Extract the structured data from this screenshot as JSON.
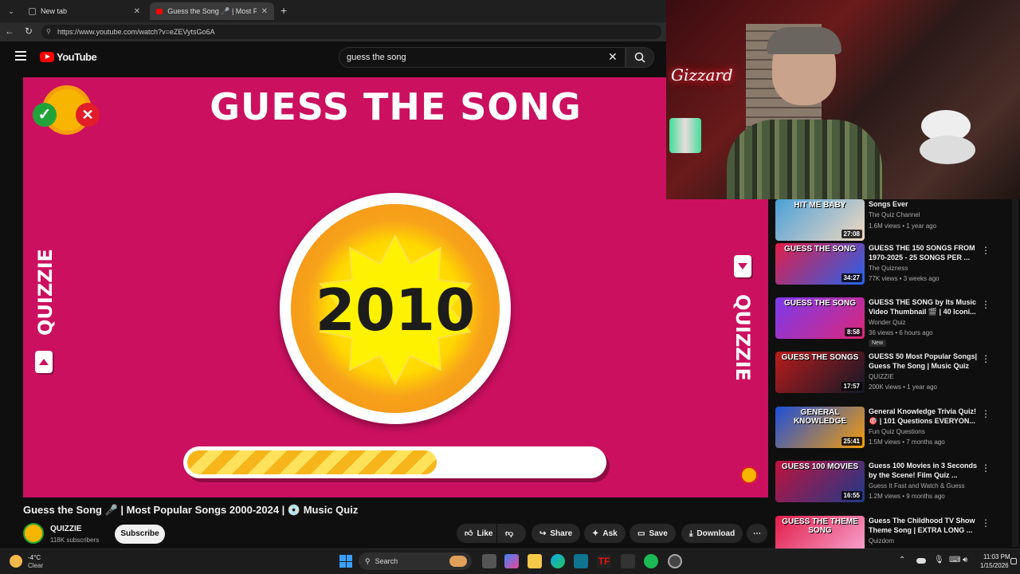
{
  "browser": {
    "tabs": [
      {
        "label": "New tab"
      },
      {
        "label": "Guess the Song 🎤 | Most Popula"
      }
    ],
    "url": "https://www.youtube.com/watch?v=eZEVytsGo6A"
  },
  "youtube": {
    "logo_text": "YouTube",
    "search_value": "guess the song"
  },
  "video": {
    "overlay_title": "GUESS THE SONG",
    "year": "2010",
    "side_label_left": "QUIZZIE",
    "side_label_right": "QUIZZIE",
    "progress_fraction": 0.6,
    "title": "Guess the Song 🎤 | Most Popular Songs 2000-2024 | 💿 Music Quiz",
    "channel": "QUIZZIE",
    "subscribers": "118K subscribers",
    "subscribe_label": "Subscribe",
    "actions": {
      "like": "Like",
      "share": "Share",
      "ask": "Ask",
      "save": "Save",
      "download": "Download"
    }
  },
  "webcam": {
    "neon_sign": "Gizzard"
  },
  "recommendations": [
    {
      "title": "Songs Ever",
      "channel": "The Quiz Channel",
      "meta": "1.6M views • 1 year ago",
      "duration": "27:08",
      "thumb_text": "HIT ME BABY",
      "colors": [
        "#4aa0d8",
        "#f3d9c0"
      ]
    },
    {
      "title": "GUESS THE 150 SONGS FROM 1970-2025 - 25 SONGS PER ...",
      "channel": "The Quizness",
      "meta": "77K views • 3 weeks ago",
      "duration": "34:27",
      "thumb_text": "GUESS THE SONG",
      "colors": [
        "#e11d48",
        "#2563eb"
      ]
    },
    {
      "title": "GUESS THE SONG by Its Music Video Thumbnail 🎬 | 40 Iconi...",
      "channel": "Wonder Quiz",
      "meta": "36 views • 6 hours ago",
      "duration": "8:58",
      "badge": "New",
      "thumb_text": "GUESS THE SONG",
      "colors": [
        "#7c3aed",
        "#db2777"
      ]
    },
    {
      "title": "GUESS 50 Most Popular Songs| Guess The Song | Music Quiz",
      "channel": "QUIZZIE",
      "meta": "200K views • 1 year ago",
      "duration": "17:57",
      "thumb_text": "GUESS THE SONGS",
      "colors": [
        "#b91c1c",
        "#111827"
      ]
    },
    {
      "title": "General Knowledge Trivia Quiz! 🎯 | 101 Questions EVERYON...",
      "channel": "Fun Quiz Questions",
      "meta": "1.5M views • 7 months ago",
      "duration": "25:41",
      "thumb_text": "GENERAL KNOWLEDGE",
      "colors": [
        "#1d4ed8",
        "#f59e0b"
      ]
    },
    {
      "title": "Guess 100 Movies in 3 Seconds by the Scene! Film Quiz ...",
      "channel": "Guess It Fast and Watch & Guess",
      "meta": "1.2M views • 9 months ago",
      "duration": "16:55",
      "thumb_text": "GUESS 100 MOVIES",
      "colors": [
        "#be123c",
        "#1e3a8a"
      ]
    },
    {
      "title": "Guess The Childhood TV Show Theme Song | EXTRA LONG ...",
      "channel": "Quizdom",
      "meta": "",
      "duration": "",
      "thumb_text": "GUESS THE THEME SONG",
      "colors": [
        "#e11d48",
        "#f9a8d4"
      ]
    }
  ],
  "taskbar": {
    "weather_temp": "-4°C",
    "weather_desc": "Clear",
    "search_label": "Search",
    "time": "11:03 PM",
    "date": "1/15/2026"
  }
}
